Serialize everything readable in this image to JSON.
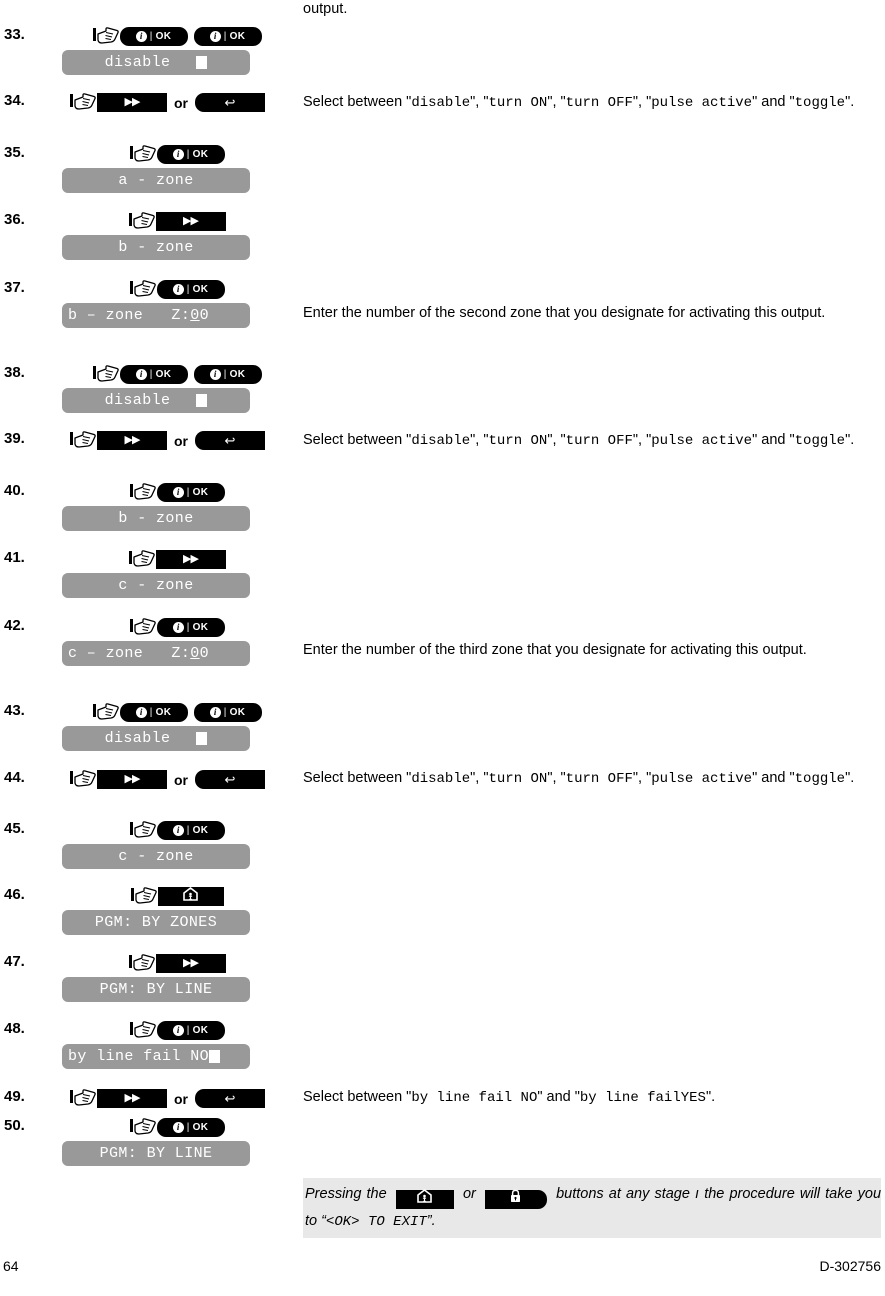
{
  "footer": {
    "page_number": "64",
    "doc_code": "D-302756"
  },
  "intro_text": "output.",
  "labels": {
    "or": "or",
    "ok_label": "OK",
    "separator": "|",
    "next_glyph": "▶▶",
    "back_glyph": "↩",
    "home_glyph": "home-icon",
    "lock_glyph": "lock-icon"
  },
  "steps": [
    {
      "num": "33.",
      "keys": [
        "ok",
        "ok"
      ],
      "align": "center",
      "lcd": "disable",
      "lcd_cursor": true
    },
    {
      "num": "34.",
      "keys": [
        "next",
        "or",
        "back"
      ],
      "align": "leftish",
      "lcd": null
    },
    {
      "num": "35.",
      "keys": [
        "ok"
      ],
      "align": "center",
      "lcd": "a - zone"
    },
    {
      "num": "36.",
      "keys": [
        "next"
      ],
      "align": "center",
      "lcd": "b - zone"
    },
    {
      "num": "37.",
      "keys": [
        "ok"
      ],
      "align": "center",
      "lcd": "b – zone   Z:00",
      "lcd_underline_index": 1
    },
    {
      "num": "38.",
      "keys": [
        "ok",
        "ok"
      ],
      "align": "center",
      "lcd": "disable",
      "lcd_cursor": true
    },
    {
      "num": "39.",
      "keys": [
        "next",
        "or",
        "back"
      ],
      "align": "leftish",
      "lcd": null
    },
    {
      "num": "40.",
      "keys": [
        "ok"
      ],
      "align": "center",
      "lcd": "b - zone"
    },
    {
      "num": "41.",
      "keys": [
        "next"
      ],
      "align": "center",
      "lcd": "c - zone"
    },
    {
      "num": "42.",
      "keys": [
        "ok"
      ],
      "align": "center",
      "lcd": "c – zone   Z:00",
      "lcd_underline_index": 1
    },
    {
      "num": "43.",
      "keys": [
        "ok",
        "ok"
      ],
      "align": "center",
      "lcd": "disable",
      "lcd_cursor": true
    },
    {
      "num": "44.",
      "keys": [
        "next",
        "or",
        "back"
      ],
      "align": "leftish",
      "lcd": null
    },
    {
      "num": "45.",
      "keys": [
        "ok"
      ],
      "align": "center",
      "lcd": "c - zone"
    },
    {
      "num": "46.",
      "keys": [
        "home"
      ],
      "align": "center",
      "lcd": "PGM: BY ZONES"
    },
    {
      "num": "47.",
      "keys": [
        "next"
      ],
      "align": "center",
      "lcd": "PGM: BY LINE"
    },
    {
      "num": "48.",
      "keys": [
        "ok"
      ],
      "align": "center",
      "lcd": "by line fail NO",
      "lcd_cursor_inline": true
    },
    {
      "num": "49.",
      "keys": [
        "next",
        "or",
        "back"
      ],
      "align": "leftish",
      "lcd": null
    },
    {
      "num": "50.",
      "keys": [
        "ok"
      ],
      "align": "center",
      "lcd": "PGM: BY LINE"
    }
  ],
  "descriptions": {
    "select_disable_line1_a": "Select between \"",
    "d_disable": "disable",
    "d_turn_on": "turn ON",
    "d_turn_off": "turn OFF",
    "d_pulse_active": "pulse active",
    "d_toggle": "toggle",
    "select_and": "and \"",
    "second_zone": "Enter the number of the second zone that you designate for activating this output.",
    "third_zone": "Enter the number of the third zone that you designate for activating this output.",
    "select_line_fail_prefix": "Select between \"",
    "line_fail_no": "by line fail NO",
    "line_fail_yes": "by line failYES"
  },
  "note": {
    "part1": "Pressing the",
    "part2": "or",
    "part3": "buttons at any stage  ı the procedure will take you to “",
    "exit_text": "<OK> TO EXIT",
    "part4": "”."
  }
}
